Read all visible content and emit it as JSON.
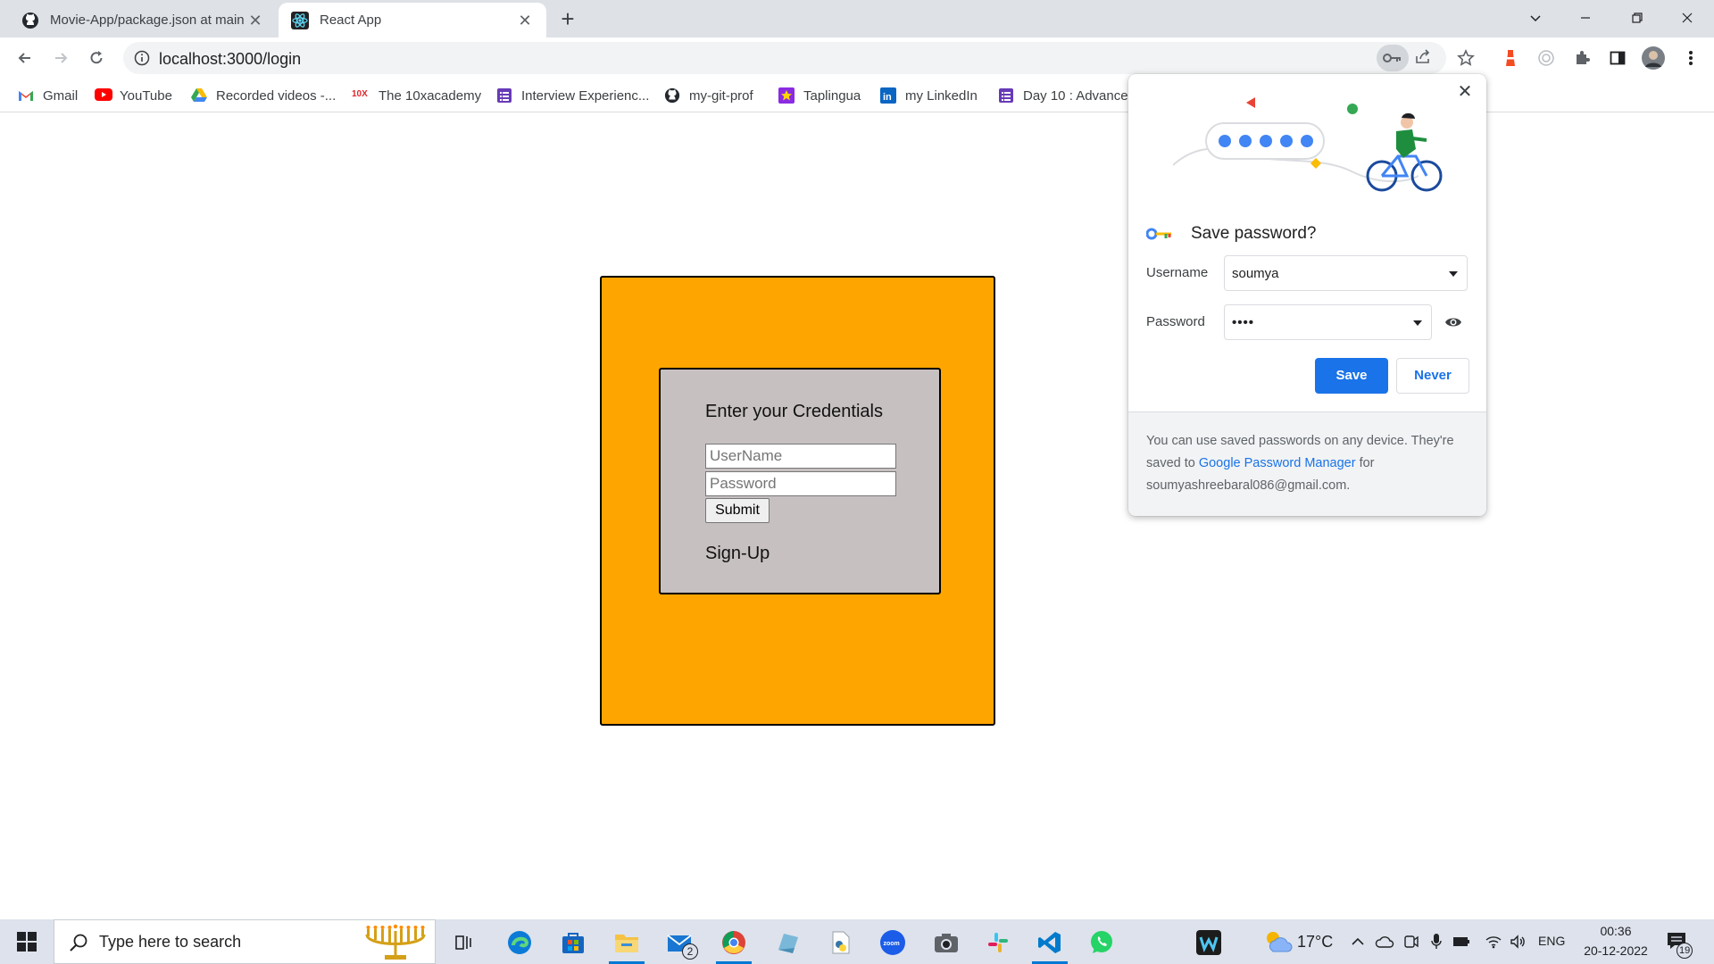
{
  "browser": {
    "tabs": [
      {
        "title": "Movie-App/package.json at main",
        "favicon": "github-icon"
      },
      {
        "title": "React App",
        "favicon": "react-icon",
        "active": true
      }
    ],
    "url": "localhost:3000/login",
    "bookmarks": [
      {
        "label": "Gmail",
        "icon": "gmail-icon"
      },
      {
        "label": "YouTube",
        "icon": "youtube-icon"
      },
      {
        "label": "Recorded videos -...",
        "icon": "google-drive-icon"
      },
      {
        "label": "The 10xacademy",
        "icon": "10x-icon"
      },
      {
        "label": "Interview Experienc...",
        "icon": "forms-icon"
      },
      {
        "label": "my-git-prof",
        "icon": "github-icon"
      },
      {
        "label": "Taplingua",
        "icon": "star-icon"
      },
      {
        "label": "my LinkedIn",
        "icon": "linkedin-icon"
      },
      {
        "label": "Day 10 : Advance",
        "icon": "forms-icon"
      }
    ]
  },
  "login": {
    "heading": "Enter your Credentials",
    "username_placeholder": "UserName",
    "password_placeholder": "Password",
    "submit_label": "Submit",
    "signup_label": "Sign-Up"
  },
  "save_password": {
    "title": "Save password?",
    "username_label": "Username",
    "username_value": "soumya",
    "password_label": "Password",
    "password_value": "••••",
    "save_label": "Save",
    "never_label": "Never",
    "footer_text_1": "You can use saved passwords on any device. They're saved to ",
    "footer_link": "Google Password Manager",
    "footer_text_2": " for soumyashreebaral086@gmail.com."
  },
  "taskbar": {
    "search_placeholder": "Type here to search",
    "mail_badge": "2",
    "temperature": "17°C",
    "language": "ENG",
    "time": "00:36",
    "date": "20-12-2022",
    "notification_count": "19"
  },
  "colors": {
    "outer_box": "#ffa500",
    "cred_box": "#c7c0c1",
    "accent": "#1a73e8"
  }
}
